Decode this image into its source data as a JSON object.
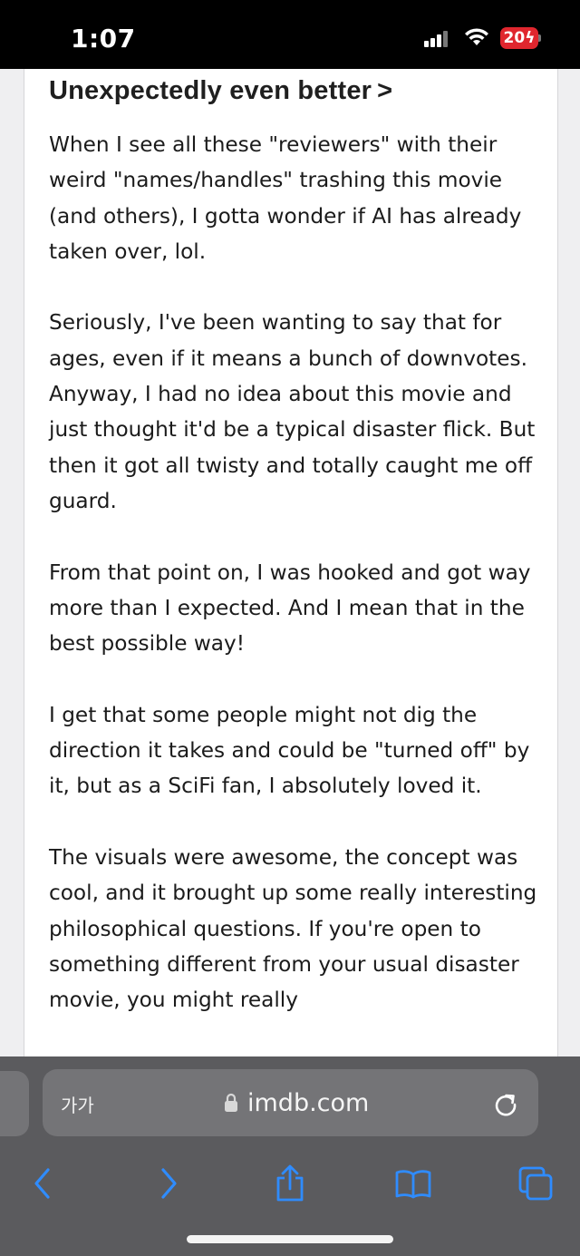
{
  "status_bar": {
    "time": "1:07",
    "battery": "20"
  },
  "review": {
    "title": "Unexpectedly even better",
    "paragraphs": [
      "When I see all these \"reviewers\" with their weird \"names/handles\" trashing this movie (and others), I gotta wonder if AI has already taken over, lol.",
      "Seriously, I've been wanting to say that for ages, even if it means a bunch of downvotes. Anyway, I had no idea about this movie and just thought it'd be a typical disaster flick. But then it got all twisty and totally caught me off guard.",
      "From that point on, I was hooked and got way more than I expected. And I mean that in the best possible way!",
      "I get that some people might not dig the direction it takes and could be \"turned off\" by it, but as a SciFi fan, I absolutely loved it.",
      "The visuals were awesome, the concept was cool, and it brought up some really interesting philosophical questions. If you're open to something different from your usual disaster movie, you might really"
    ]
  },
  "browser": {
    "text_size_label": "가가",
    "url": "imdb.com",
    "toolbar": [
      "back-icon",
      "forward-icon",
      "share-icon",
      "bookmarks-icon",
      "tabs-icon"
    ],
    "accent_color": "#2f8cff"
  }
}
